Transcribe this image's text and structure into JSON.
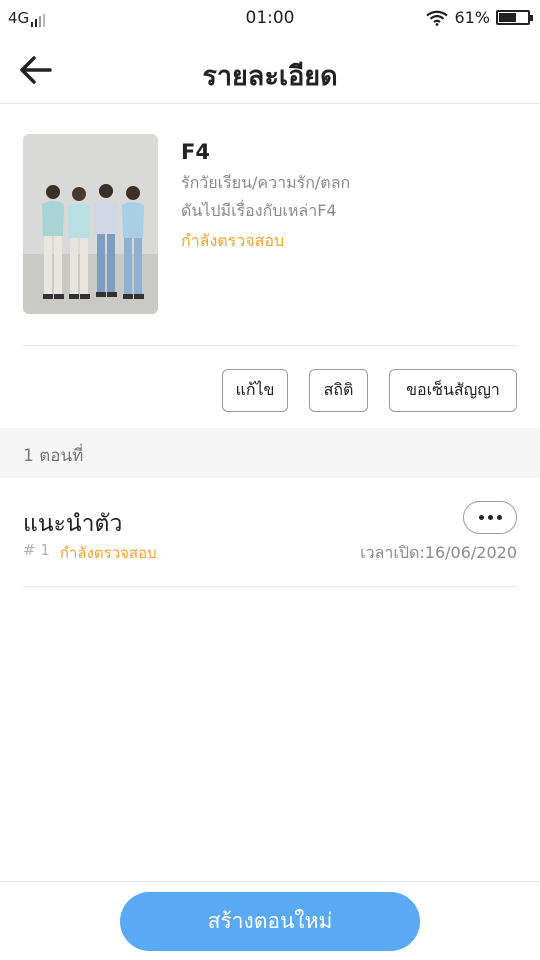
{
  "status_bar": {
    "network": "4G",
    "time": "01:00",
    "battery": "61%",
    "battery_level": 0.61,
    "wifi_icon": "wifi-icon",
    "signal_icon": "signal-icon",
    "battery_icon": "battery-icon"
  },
  "header": {
    "title": "รายละเอียด",
    "back_icon": "arrow-left-icon"
  },
  "book": {
    "title": "F4",
    "tags": "รักวัยเรียน/ความรัก/ตลก",
    "description": "ดันไปมีเรื่องกับเหล่าF4",
    "status": "กำลังตรวจสอบ",
    "status_color": "#f0a22e"
  },
  "actions": {
    "edit": "แก้ไข",
    "stats": "สถิติ",
    "contract": "ขอเซ็นสัญญา"
  },
  "episodes": {
    "count_label": "1 ตอนที่",
    "items": [
      {
        "title": "แนะนำตัว",
        "number": "# 1",
        "status": "กำลังตรวจสอบ",
        "open_time": "เวลาเปิด:16/06/2020"
      }
    ]
  },
  "bottom": {
    "create_label": "สร้างตอนใหม่",
    "accent": "#5aa9f5"
  }
}
